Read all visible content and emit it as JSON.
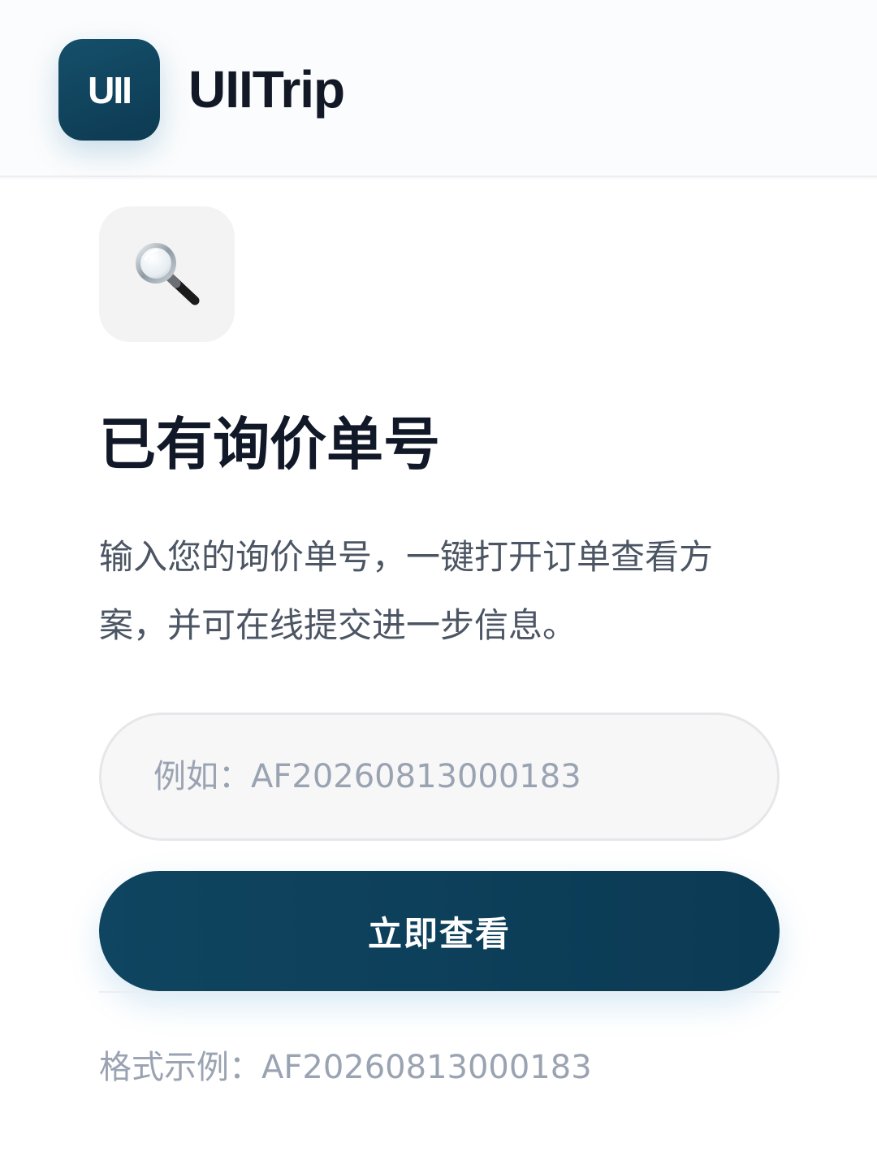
{
  "header": {
    "logo_text": "UII",
    "brand_name": "UIITrip"
  },
  "main": {
    "icon": "magnifying-glass-icon",
    "title": "已有询价单号",
    "description": "输入您的询价单号，一键打开订单查看方案，并可在线提交进一步信息。",
    "input": {
      "placeholder": "例如：AF20260813000183",
      "value": ""
    },
    "submit_label": "立即查看",
    "format_hint": "格式示例：AF20260813000183"
  },
  "colors": {
    "brand": "#0d3a52",
    "title_text": "#111827",
    "muted_text": "#9aa3b2"
  }
}
